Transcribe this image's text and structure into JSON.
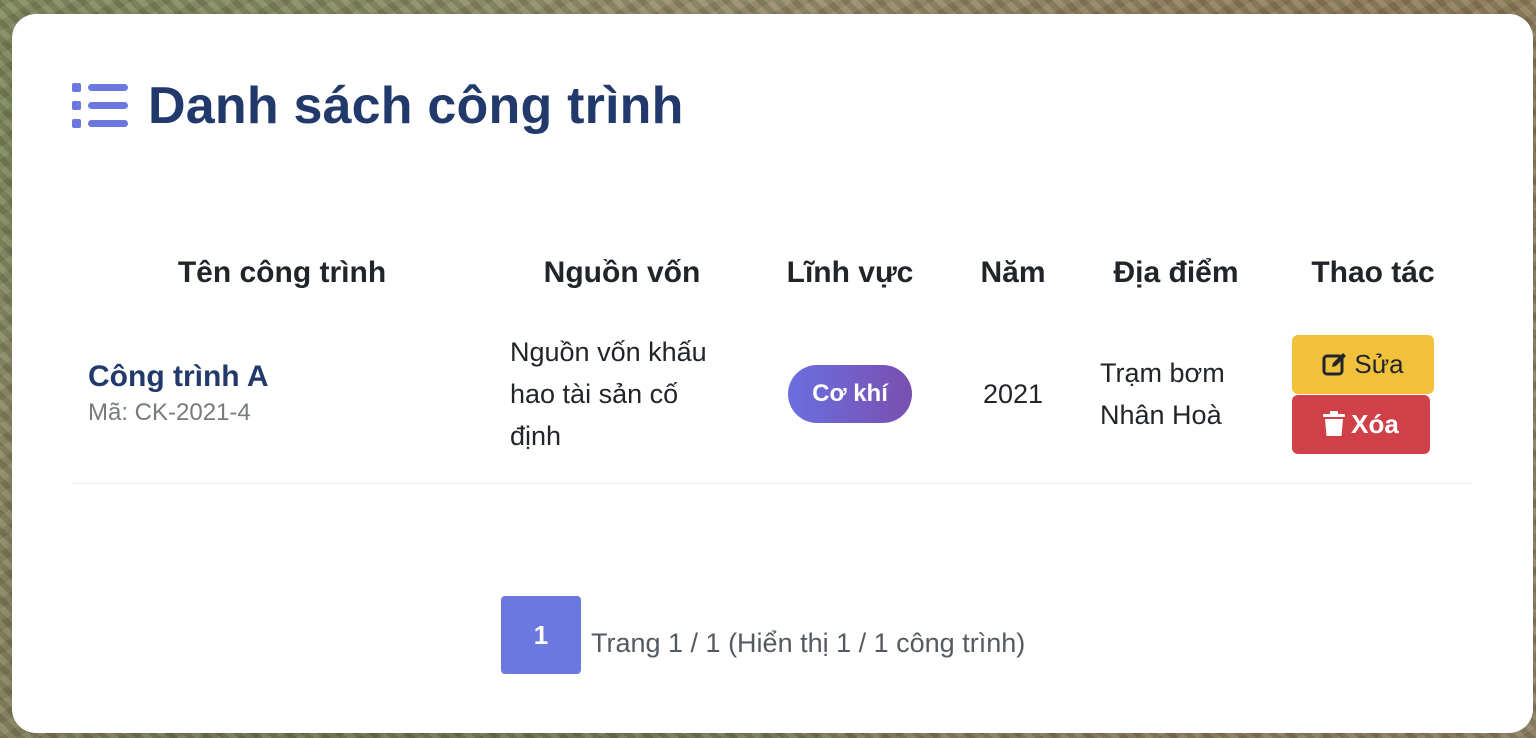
{
  "page": {
    "title": "Danh sách công trình",
    "accent_color": "#6a78e0",
    "title_color": "#223a6b"
  },
  "table": {
    "headers": [
      "Tên công trình",
      "Nguồn vốn",
      "Lĩnh vực",
      "Năm",
      "Địa điểm",
      "Thao tác"
    ],
    "rows": [
      {
        "name": "Công trình A",
        "code": "Mã: CK-2021-4",
        "source": "Nguồn vốn khấu hao tài sản cố định",
        "field": "Cơ khí",
        "year": "2021",
        "location": "Trạm bơm Nhân Hoà",
        "edit_label": "Sửa",
        "delete_label": "Xóa"
      }
    ]
  },
  "pagination": {
    "current_page": "1",
    "info": "Trang 1 / 1 (Hiển thị 1 / 1 công trình)"
  },
  "icons": {
    "title_icon": "list-icon",
    "edit_icon": "edit-icon",
    "delete_icon": "trash-icon"
  }
}
